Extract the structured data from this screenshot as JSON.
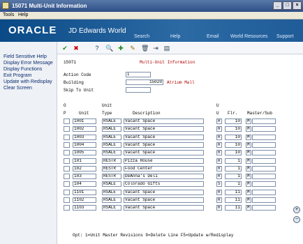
{
  "window": {
    "title": "15071    Multi-Unit Information"
  },
  "menu": {
    "tools": "Tools",
    "help": "Help"
  },
  "banner": {
    "logo": "ORACLE",
    "product": "JD Edwards World",
    "search": "Search",
    "help": "Help",
    "email": "Email",
    "world_resources": "World Resources",
    "support": "Support"
  },
  "toolbar": {
    "ok": "✔",
    "cancel": "✖",
    "help": "?",
    "find": "🔍",
    "add": "✚",
    "change": "✎",
    "delete": "🗑",
    "export": "⇥",
    "print": "▤"
  },
  "sidebar": {
    "items": [
      "Field Sensitive Help",
      "Display Error Message",
      "Display Functions",
      "Exit Program",
      "Update with Redisplay",
      "Clear Screen"
    ]
  },
  "form": {
    "program": "15071",
    "title": "Multi-Unit Information",
    "action_code_label": "Action Code",
    "action_code": "I",
    "building_label": "Building",
    "building": "15020",
    "building_name": "Atrium Mall",
    "skip_label": "Skip To Unit",
    "skip": ""
  },
  "grid": {
    "h_o": "O",
    "h_p": "P",
    "h_unit": "Unit",
    "h_unit2": "Unit",
    "h_type": "Type",
    "h_desc": "Description",
    "h_u1": "U",
    "h_u2": "U",
    "h_flr": "Flr.",
    "h_ms": "Master/Sub",
    "rows": [
      {
        "unit": "1001",
        "type": "RSALE",
        "desc": "Vacant Space",
        "u": "R",
        "flr": "10",
        "ms": "M"
      },
      {
        "unit": "1002",
        "type": "RSALE",
        "desc": "Vacant Space",
        "u": "R",
        "flr": "10",
        "ms": "M"
      },
      {
        "unit": "1003",
        "type": "RSALE",
        "desc": "Vacant Space",
        "u": "R",
        "flr": "10",
        "ms": "M"
      },
      {
        "unit": "1004",
        "type": "RSALE",
        "desc": "Vacant Space",
        "u": "R",
        "flr": "10",
        "ms": "M"
      },
      {
        "unit": "1005",
        "type": "RSALE",
        "desc": "Vacant Space",
        "u": "R",
        "flr": "10",
        "ms": "M"
      },
      {
        "unit": "101",
        "type": "RESTR",
        "desc": "Pizza House",
        "u": "R",
        "flr": "1",
        "ms": "M"
      },
      {
        "unit": "102",
        "type": "RESTR",
        "desc": "Food Center",
        "u": "R",
        "flr": "1",
        "ms": "M"
      },
      {
        "unit": "103",
        "type": "RESTR",
        "desc": "DeAnna's Deli",
        "u": "R",
        "flr": "1",
        "ms": "M"
      },
      {
        "unit": "104",
        "type": "RSALE",
        "desc": "Colorado Gifts",
        "u": "S",
        "flr": "1",
        "ms": "M"
      },
      {
        "unit": "1101",
        "type": "RSALE",
        "desc": "Vacant Space",
        "u": "R",
        "flr": "11",
        "ms": "M"
      },
      {
        "unit": "1102",
        "type": "RSALE",
        "desc": "Vacant Space",
        "u": "R",
        "flr": "11",
        "ms": "M"
      },
      {
        "unit": "1103",
        "type": "RSALE",
        "desc": "Vacant Space",
        "u": "R",
        "flr": "11",
        "ms": "M"
      }
    ]
  },
  "footer": {
    "options": "Opt:  1=Unit Master Revisions  9=Delete Line  F5=Update w/Redisplay"
  },
  "scroll": {
    "up": "+",
    "down": "−"
  }
}
